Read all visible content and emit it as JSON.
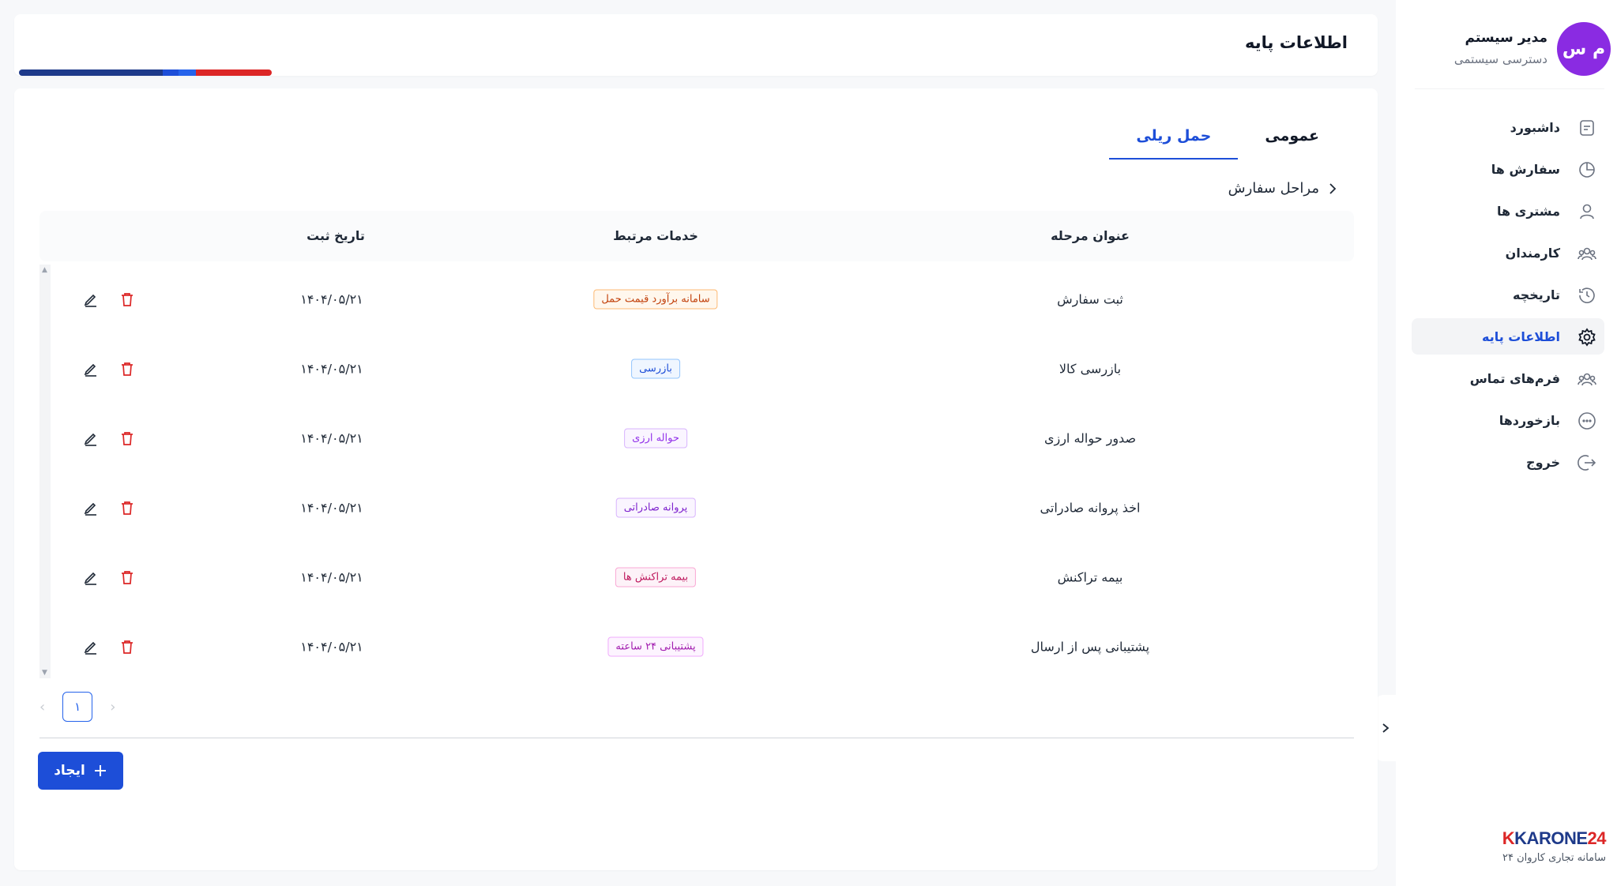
{
  "profile": {
    "initials": "م س",
    "name": "مدیر سیستم",
    "role": "دسترسی سیستمی"
  },
  "nav": [
    {
      "label": "داشبورد",
      "icon": "dashboard-icon",
      "active": false
    },
    {
      "label": "سفارش ها",
      "icon": "orders-icon",
      "active": false
    },
    {
      "label": "مشتری ها",
      "icon": "user-icon",
      "active": false
    },
    {
      "label": "کارمندان",
      "icon": "users-icon",
      "active": false
    },
    {
      "label": "تاریخچه",
      "icon": "history-icon",
      "active": false
    },
    {
      "label": "اطلاعات پایه",
      "icon": "gear-icon",
      "active": true
    },
    {
      "label": "فرم‌های تماس",
      "icon": "contacts-icon",
      "active": false
    },
    {
      "label": "بازخوردها",
      "icon": "feedback-icon",
      "active": false
    },
    {
      "label": "خروج",
      "icon": "logout-icon",
      "active": false
    }
  ],
  "brand": {
    "logo_mark": "K",
    "logo_text": "KARONE",
    "logo_num": "24",
    "subtitle": "سامانه تجاری کاروان ۲۴"
  },
  "header": {
    "title": "اطلاعات پایه"
  },
  "tabs": [
    {
      "label": "عمومی",
      "active": false
    },
    {
      "label": "حمل ریلی",
      "active": true
    }
  ],
  "section": {
    "title": "مراحل سفارش"
  },
  "table": {
    "columns": {
      "title": "عنوان مرحله",
      "services": "خدمات مرتبط",
      "date": "تاریخ ثبت"
    },
    "rows": [
      {
        "title": "ثبت سفارش",
        "service": "سامانه برآورد قیمت حمل",
        "date": "۱۴۰۴/۰۵/۲۱",
        "tag_color": "#c2410c",
        "tag_bg": "#fff7ed",
        "tag_border": "#fdba74"
      },
      {
        "title": "بازرسی کالا",
        "service": "بازرسی",
        "date": "۱۴۰۴/۰۵/۲۱",
        "tag_color": "#1d4ed8",
        "tag_bg": "#eff6ff",
        "tag_border": "#93c5fd"
      },
      {
        "title": "صدور حواله ارزی",
        "service": "حواله ارزی",
        "date": "۱۴۰۴/۰۵/۲۱",
        "tag_color": "#9333ea",
        "tag_bg": "#faf5ff",
        "tag_border": "#d8b4fe"
      },
      {
        "title": "اخذ پروانه صادراتی",
        "service": "پروانه صادراتی",
        "date": "۱۴۰۴/۰۵/۲۱",
        "tag_color": "#7e22ce",
        "tag_bg": "#faf5ff",
        "tag_border": "#d8b4fe"
      },
      {
        "title": "بیمه تراکنش",
        "service": "بیمه تراکنش ها",
        "date": "۱۴۰۴/۰۵/۲۱",
        "tag_color": "#be185d",
        "tag_bg": "#fdf2f8",
        "tag_border": "#f9a8d4"
      },
      {
        "title": "پشتیبانی پس از ارسال",
        "service": "پشتیبانی ۲۴ ساعته",
        "date": "۱۴۰۴/۰۵/۲۱",
        "tag_color": "#a21caf",
        "tag_bg": "#fdf4ff",
        "tag_border": "#f0abfc"
      }
    ]
  },
  "pagination": {
    "current": "۱"
  },
  "create_button": {
    "label": "ایجاد"
  },
  "colors": {
    "primary": "#1d4ed8",
    "danger": "#dc2626",
    "avatar": "#8a2be2"
  }
}
